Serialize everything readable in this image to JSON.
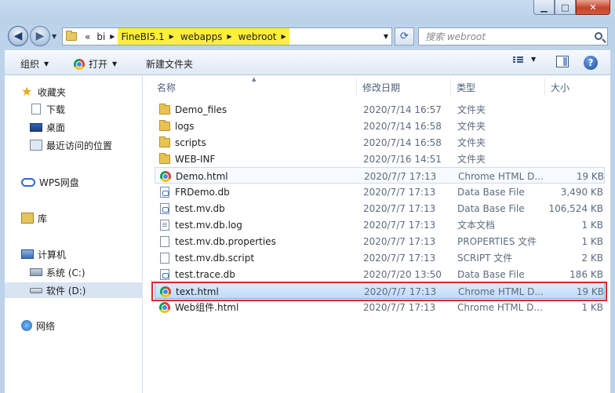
{
  "window": {
    "controls": {
      "minimize": "▁",
      "maximize": "□",
      "close": "✕"
    }
  },
  "address": {
    "overflow": "«",
    "crumbs": [
      "bi",
      "FineBI5.1",
      "webapps",
      "webroot"
    ],
    "highlight_color": "#ffee3a"
  },
  "search": {
    "placeholder": "搜索 webroot"
  },
  "toolbar": {
    "organize_label": "组织",
    "open_label": "打开",
    "new_folder_label": "新建文件夹"
  },
  "sidebar": {
    "favorites": {
      "label": "收藏夹",
      "items": [
        "下载",
        "桌面",
        "最近访问的位置"
      ]
    },
    "wps": {
      "label": "WPS网盘"
    },
    "libraries": {
      "label": "库"
    },
    "computer": {
      "label": "计算机",
      "items": [
        "系统 (C:)",
        "软件 (D:)"
      ]
    },
    "network": {
      "label": "网络"
    }
  },
  "columns": {
    "name": "名称",
    "date": "修改日期",
    "type": "类型",
    "size": "大小"
  },
  "files": [
    {
      "name": "Demo_files",
      "date": "2020/7/14 16:57",
      "type": "文件夹",
      "size": "",
      "icon": "folder-icon"
    },
    {
      "name": "logs",
      "date": "2020/7/14 16:58",
      "type": "文件夹",
      "size": "",
      "icon": "folder-icon"
    },
    {
      "name": "scripts",
      "date": "2020/7/14 16:58",
      "type": "文件夹",
      "size": "",
      "icon": "folder-icon"
    },
    {
      "name": "WEB-INF",
      "date": "2020/7/16 14:51",
      "type": "文件夹",
      "size": "",
      "icon": "folder-icon"
    },
    {
      "name": "Demo.html",
      "date": "2020/7/7 17:13",
      "type": "Chrome HTML D...",
      "size": "19 KB",
      "icon": "chrome-icon"
    },
    {
      "name": "FRDemo.db",
      "date": "2020/7/7 17:13",
      "type": "Data Base File",
      "size": "3,490 KB",
      "icon": "db-file-icon"
    },
    {
      "name": "test.mv.db",
      "date": "2020/7/7 17:13",
      "type": "Data Base File",
      "size": "106,524 KB",
      "icon": "db-file-icon"
    },
    {
      "name": "test.mv.db.log",
      "date": "2020/7/7 17:13",
      "type": "文本文档",
      "size": "1 KB",
      "icon": "text-file-icon"
    },
    {
      "name": "test.mv.db.properties",
      "date": "2020/7/7 17:13",
      "type": "PROPERTIES 文件",
      "size": "1 KB",
      "icon": "blank-file-icon"
    },
    {
      "name": "test.mv.db.script",
      "date": "2020/7/7 17:13",
      "type": "SCRIPT 文件",
      "size": "2 KB",
      "icon": "blank-file-icon"
    },
    {
      "name": "test.trace.db",
      "date": "2020/7/20 13:50",
      "type": "Data Base File",
      "size": "186 KB",
      "icon": "db-file-icon"
    },
    {
      "name": "text.html",
      "date": "2020/7/7 17:13",
      "type": "Chrome HTML D...",
      "size": "19 KB",
      "icon": "chrome-icon"
    },
    {
      "name": "Web组件.html",
      "date": "2020/7/7 17:13",
      "type": "Chrome HTML D...",
      "size": "1 KB",
      "icon": "chrome-icon"
    }
  ],
  "colors": {
    "selection_outline": "#d9282c",
    "selected_row": "#c1dbfc"
  }
}
